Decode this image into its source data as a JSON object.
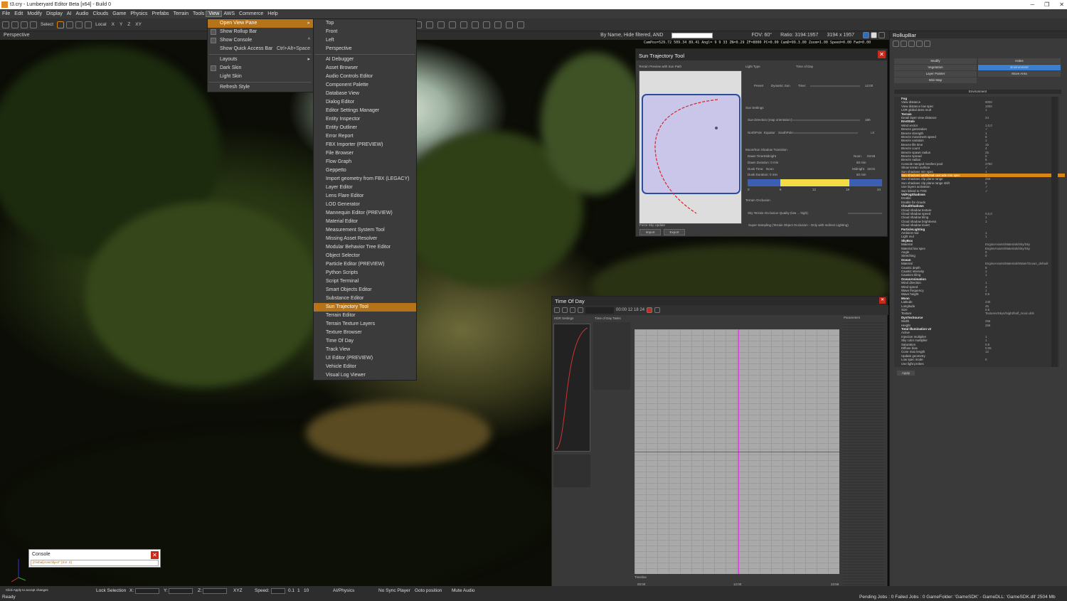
{
  "window": {
    "title": "t3.cry - Lumberyard Editor Beta [x64] - Build 0",
    "min": "─",
    "max": "❐",
    "close": "✕"
  },
  "menubar": [
    "File",
    "Edit",
    "Modify",
    "Display",
    "AI",
    "Audio",
    "Clouds",
    "Game",
    "Physics",
    "Prefabs",
    "Terrain",
    "Tools",
    "View",
    "AWS",
    "Commerce",
    "Help"
  ],
  "toolbar": {
    "select_label": "Select",
    "local_label": "Local",
    "axes": [
      "X",
      "Y",
      "Z",
      "XY"
    ]
  },
  "viewport": {
    "name": "Perspective",
    "filter": "By Name, Hide filtered, AND",
    "fov_label": "FOV:",
    "fov": "60°",
    "ratio_label": "Ratio:",
    "ratio": "3194:1957",
    "size": "3194 x 1957",
    "coords": "CamPos=529.72 509.34 89.41 Angl=  9  9   33 ZN=0.29 ZF=8000 PC=0.00 CamD=99.3.00 Zoom=1.00 Speed=0.00 Fwd=0.00"
  },
  "view_menu": [
    {
      "label": "Open View Pane",
      "selected": true,
      "submenu": true
    },
    {
      "label": "Show Rollup Bar",
      "check": true
    },
    {
      "label": "Show Console",
      "check": true,
      "shortcut": "^"
    },
    {
      "label": "Show Quick Access Bar",
      "shortcut": "Ctrl+Alt+Space"
    },
    {
      "sep": true
    },
    {
      "label": "Layouts",
      "submenu": true
    },
    {
      "label": "Dark Skin",
      "check": true
    },
    {
      "label": "Light Skin"
    },
    {
      "sep": true
    },
    {
      "label": "Refresh Style"
    }
  ],
  "pane_menu": [
    "Top",
    "Front",
    "Left",
    "Perspective",
    "AI Debugger",
    "Asset Browser",
    "Audio Controls Editor",
    "Component Palette",
    "Database View",
    "Dialog Editor",
    "Editor Settings Manager",
    "Entity Inspector",
    "Entity Outliner",
    "Error Report",
    "FBX Importer (PREVIEW)",
    "File Browser",
    "Flow Graph",
    "Geppetto",
    "Import geometry from FBX (LEGACY)",
    "Layer Editor",
    "Lens Flare Editor",
    "LOD Generator",
    "Mannequin Editor (PREVIEW)",
    "Material Editor",
    "Measurement System Tool",
    "Missing Asset Resolver",
    "Modular Behavior Tree Editor",
    "Object Selector",
    "Particle Editor (PREVIEW)",
    "Python Scripts",
    "Script Terminal",
    "Smart Objects Editor",
    "Substance Editor",
    "Sun Trajectory Tool",
    "Terrain Editor",
    "Terrain Texture Layers",
    "Texture Browser",
    "Time Of Day",
    "Track View",
    "UI Editor (PREVIEW)",
    "Vehicle Editor",
    "Visual Log Viewer"
  ],
  "pane_menu_selected": "Sun Trajectory Tool",
  "sun_tool": {
    "title": "Sun Trajectory Tool",
    "preview_label": "Terrain Preview with Sun Path",
    "light_type": "Light Type",
    "time_of_day": "Time of Day",
    "preset": "Preset",
    "dynamic_sun": "Dynamic Sun",
    "time_label": "Time:",
    "time_value": "12:00",
    "sun_settings": "Sun Settings",
    "sun_direction": "Sun Direction (map orientation):",
    "sun_dir_value": "180",
    "north_pole": "NorthPole",
    "equator": "Equator",
    "south_pole": "SouthPole:",
    "lat_value": "LE",
    "moon_transition": "Moon/Sun Shadow Transition",
    "dawn_time": "Dawn Time:",
    "midnight": "Midnight",
    "noon": "Noon",
    "dawn_value": "03:59",
    "dawn_duration": "Dawn Duration: 0 min",
    "dur_value1": "60 min",
    "dusk_time": "Dusk Time:",
    "dusk_value": "18:01",
    "dusk_duration": "Dusk Duration: 0 min",
    "dur_value2": "60 min",
    "ticks": [
      "0",
      "6",
      "12",
      "18",
      "24"
    ],
    "terrain_occlusion": "Terrain Occlusion",
    "occ_quality": "Sky Terrain Occlusion Quality (low ... high):",
    "super_sampling": "Super Sampling (Terrain Object Occlusion - Only with Indirect Lighting)",
    "force_sky": "Force Sky Update",
    "import": "Import",
    "export": "Export"
  },
  "tod": {
    "title": "Time Of Day",
    "time_display": "00:00 12 18 24",
    "hdr_settings": "HDR Settings",
    "tasks": "Time of Day Tasks",
    "params": "Parameters",
    "timeline": "Timeline",
    "t_start": "00:00",
    "t_mid": "12:00",
    "t_end": "23:59"
  },
  "rollup": {
    "title": "RollupBar",
    "tabs": [
      "Modify",
      "Holes",
      "Vegetation",
      "Environment",
      "Layer Painter",
      "Move Area",
      "Mini Map"
    ],
    "active_tab": "Environment",
    "section": "Environment",
    "apply": "Apply",
    "rows": [
      {
        "n": "Fog",
        "g": true
      },
      {
        "n": "View distance",
        "v": "8000"
      },
      {
        "n": "View distance low spec",
        "v": "1000"
      },
      {
        "n": "LDR global dens mult",
        "v": "1"
      },
      {
        "n": "Terrain",
        "g": true
      },
      {
        "n": "Detail layer view distance",
        "v": "24"
      },
      {
        "n": "EnvState",
        "g": true
      },
      {
        "n": "Wind vector",
        "v": "1,0,0"
      },
      {
        "n": "Breeze generation",
        "v": "✓"
      },
      {
        "n": "Breeze strength",
        "v": "1"
      },
      {
        "n": "Breeze movement speed",
        "v": "8"
      },
      {
        "n": "Breeze variation",
        "v": "1"
      },
      {
        "n": "Breeze life time",
        "v": "15"
      },
      {
        "n": "Breeze count",
        "v": "4"
      },
      {
        "n": "Breeze spawn radius",
        "v": "25"
      },
      {
        "n": "Breeze spread",
        "v": "0"
      },
      {
        "n": "Breeze radius",
        "v": "5"
      },
      {
        "n": "Console merged meshes pool",
        "v": "2750"
      },
      {
        "n": "Show terrain surface",
        "v": "✓"
      },
      {
        "n": "Sun shadows min spec",
        "v": "1"
      },
      {
        "n": "Sun shadows additional cascade min spec",
        "v": "0",
        "hl": true
      },
      {
        "n": "Sun shadows clip plane range",
        "v": "256"
      },
      {
        "n": "Sun shadows clip plane range shift",
        "v": "0"
      },
      {
        "n": "Use layers activation",
        "v": "✓"
      },
      {
        "n": "Sun linked to TOD",
        "v": "✓"
      },
      {
        "n": "VolFogShadows",
        "g": true
      },
      {
        "n": "Enable",
        "v": ""
      },
      {
        "n": "Enable for clouds",
        "v": ""
      },
      {
        "n": "CloudShadows",
        "g": true
      },
      {
        "n": "Cloud shadow texture",
        "v": ""
      },
      {
        "n": "Cloud shadow speed",
        "v": "0,0,0"
      },
      {
        "n": "Cloud shadow tiling",
        "v": "1"
      },
      {
        "n": "Cloud shadow brightness",
        "v": "1"
      },
      {
        "n": "Cloud shadow invert",
        "v": ""
      },
      {
        "n": "ParticleLighting",
        "g": true
      },
      {
        "n": "Ambient mul",
        "v": "1"
      },
      {
        "n": "Light mul",
        "v": "1"
      },
      {
        "n": "SkyBox",
        "g": true
      },
      {
        "n": "Material",
        "v": "EngineAssets/Materials/Sky/Sky"
      },
      {
        "n": "Material low spec",
        "v": "EngineAssets/Materials/Sky/Sky"
      },
      {
        "n": "Angle",
        "v": "0"
      },
      {
        "n": "Stretching",
        "v": "0"
      },
      {
        "n": "Ocean",
        "g": true
      },
      {
        "n": "Material",
        "v": "EngineAssets/Materials/Water/Ocean_default"
      },
      {
        "n": "Caustic depth",
        "v": "8"
      },
      {
        "n": "Caustic intensity",
        "v": "1"
      },
      {
        "n": "Caustics tiling",
        "v": "1"
      },
      {
        "n": "OceanAnimation",
        "g": true
      },
      {
        "n": "Wind direction",
        "v": "1"
      },
      {
        "n": "Wind speed",
        "v": "4"
      },
      {
        "n": "Wave frequency",
        "v": "1"
      },
      {
        "n": "Wave height",
        "v": "0.5"
      },
      {
        "n": "Moon",
        "g": true
      },
      {
        "n": "Latitude",
        "v": "240"
      },
      {
        "n": "Longitude",
        "v": "45"
      },
      {
        "n": "Size",
        "v": "0.5"
      },
      {
        "n": "Texture",
        "v": "Textures/Skys/Night/half_moon.dds"
      },
      {
        "n": "DynTexSource",
        "g": true
      },
      {
        "n": "Width",
        "v": "256"
      },
      {
        "n": "Height",
        "v": "256"
      },
      {
        "n": "Total Illumination v2",
        "g": true
      },
      {
        "n": "Active",
        "v": ""
      },
      {
        "n": "Injection multiplier",
        "v": "1"
      },
      {
        "n": "Sky color multiplier",
        "v": "1"
      },
      {
        "n": "Saturation",
        "v": "0.8"
      },
      {
        "n": "Diffuse bias",
        "v": "0.05"
      },
      {
        "n": "Cone max length",
        "v": "12"
      },
      {
        "n": "Update geometry",
        "v": ""
      },
      {
        "n": "Low spec mode",
        "v": "0"
      },
      {
        "n": "Use light probes",
        "v": ""
      }
    ]
  },
  "console": {
    "title": "Console",
    "text": "[Global]AnsiObject\" [SVr. 0]"
  },
  "status": {
    "ready": "Ready",
    "hint": "Click Apply to accept changes",
    "lock": "Lock Selection",
    "x": "X:",
    "y": "Y:",
    "z": "Z:",
    "xyz": "XYZ",
    "speed": "Speed:",
    "s1": "0.1",
    "s2": "1",
    "s3": "10",
    "ai": "AI/Physics",
    "no_sync": "No Sync Player",
    "goto": "Goto position",
    "mute": "Mute Audio",
    "jobs": "Pending Jobs : 0  Failed Jobs : 0  GameFolder: 'GameSDK' - GameDLL: 'GameSDK.dll'  2504 Mb"
  }
}
